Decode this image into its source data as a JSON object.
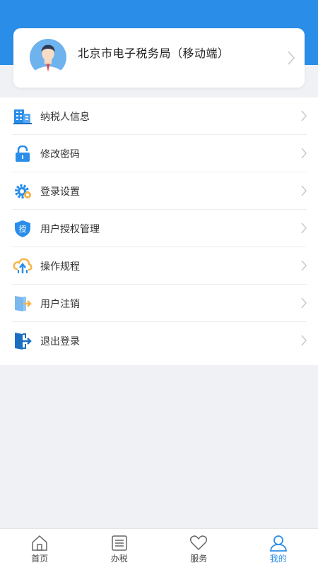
{
  "profile": {
    "name": "北京市电子税务局（移动端）"
  },
  "menu": {
    "items": [
      {
        "label": "纳税人信息",
        "icon": "building-icon"
      },
      {
        "label": "修改密码",
        "icon": "lock-icon"
      },
      {
        "label": "登录设置",
        "icon": "gear-icon"
      },
      {
        "label": "用户授权管理",
        "icon": "shield-auth-icon",
        "badge": "授"
      },
      {
        "label": "操作规程",
        "icon": "cloud-upload-icon"
      },
      {
        "label": "用户注销",
        "icon": "door-exit-icon"
      },
      {
        "label": "退出登录",
        "icon": "logout-icon"
      }
    ]
  },
  "tabbar": {
    "tabs": [
      {
        "label": "首页",
        "icon": "home-icon"
      },
      {
        "label": "办税",
        "icon": "list-icon"
      },
      {
        "label": "服务",
        "icon": "heart-icon"
      },
      {
        "label": "我的",
        "icon": "user-icon",
        "active": true
      }
    ]
  },
  "colors": {
    "brand": "#2a8ee8",
    "background": "#f0f1f5",
    "text": "#333333",
    "chevron": "#c8c8c8"
  }
}
